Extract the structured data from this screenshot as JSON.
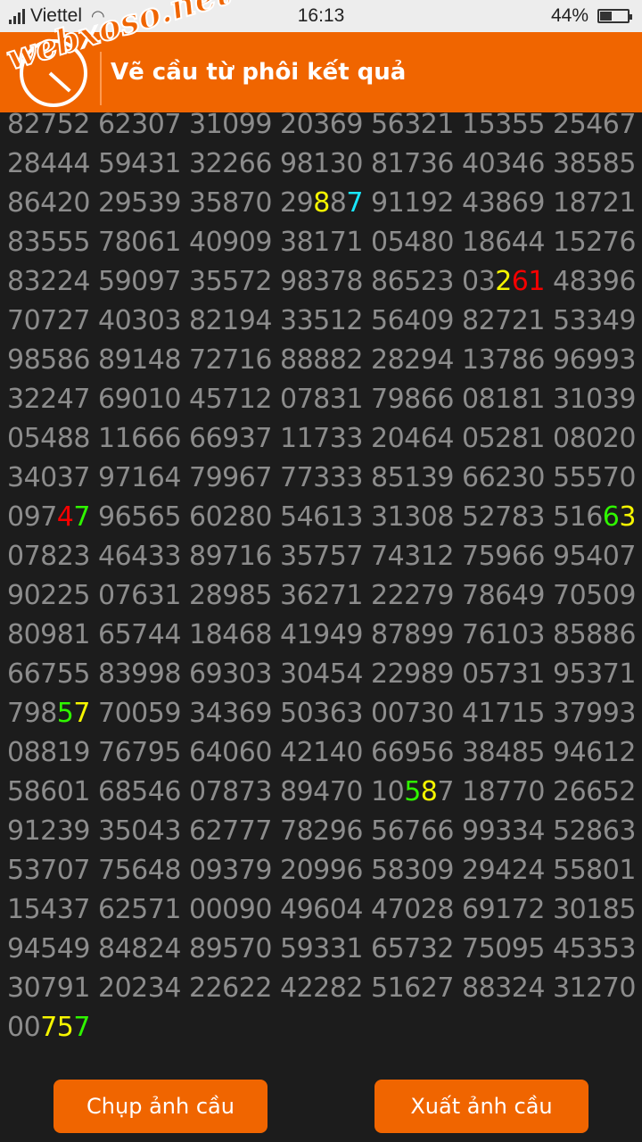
{
  "status_bar": {
    "carrier": "Viettel",
    "time": "16:13",
    "battery_percent": "44%",
    "battery_level": 0.44,
    "icons": [
      "signal-icon",
      "wifi-icon",
      "battery-icon"
    ]
  },
  "header": {
    "watermark": "webxoso.net",
    "title": "Vẽ cầu từ phôi kết quả",
    "background": "#f06500"
  },
  "grid": {
    "text_color": "#8c8c8c",
    "highlight_colors": {
      "yellow": "#f5f500",
      "cyan": "#19e7ff",
      "red": "#f50000",
      "green": "#2ff500"
    },
    "rows": [
      [
        "82752",
        "62307",
        "31099",
        "20369",
        "56321",
        "15355",
        "25467"
      ],
      [
        "28444",
        "59431",
        "32266",
        "98130",
        "81736",
        "40346",
        "38585"
      ],
      [
        "86420",
        "29539",
        "35870",
        "29887",
        "91192",
        "43869",
        "18721"
      ],
      [
        "83555",
        "78061",
        "40909",
        "38171",
        "05480",
        "18644",
        "15276"
      ],
      [
        "83224",
        "59097",
        "35572",
        "98378",
        "86523",
        "03261",
        "48396"
      ],
      [
        "70727",
        "40303",
        "82194",
        "33512",
        "56409",
        "82721",
        "53349"
      ],
      [
        "98586",
        "89148",
        "72716",
        "88882",
        "28294",
        "13786",
        "96993"
      ],
      [
        "32247",
        "69010",
        "45712",
        "07831",
        "79866",
        "08181",
        "31039"
      ],
      [
        "05488",
        "11666",
        "66937",
        "11733",
        "20464",
        "05281",
        "08020"
      ],
      [
        "34037",
        "97164",
        "79967",
        "77333",
        "85139",
        "66230",
        "55570"
      ],
      [
        "09747",
        "96565",
        "60280",
        "54613",
        "31308",
        "52783",
        "51663"
      ],
      [
        "07823",
        "46433",
        "89716",
        "35757",
        "74312",
        "75966",
        "95407"
      ],
      [
        "90225",
        "07631",
        "28985",
        "36271",
        "22279",
        "78649",
        "70509"
      ],
      [
        "80981",
        "65744",
        "18468",
        "41949",
        "87899",
        "76103",
        "85886"
      ],
      [
        "66755",
        "83998",
        "69303",
        "30454",
        "22989",
        "05731",
        "95371"
      ],
      [
        "79857",
        "70059",
        "34369",
        "50363",
        "00730",
        "41715",
        "37993"
      ],
      [
        "08819",
        "76795",
        "64060",
        "42140",
        "66956",
        "38485",
        "94612"
      ],
      [
        "58601",
        "68546",
        "07873",
        "89470",
        "10587",
        "18770",
        "26652"
      ],
      [
        "91239",
        "35043",
        "62777",
        "78296",
        "56766",
        "99334",
        "52863"
      ],
      [
        "53707",
        "75648",
        "09379",
        "20996",
        "58309",
        "29424",
        "55801"
      ],
      [
        "15437",
        "62571",
        "00090",
        "49604",
        "47028",
        "69172",
        "30185"
      ],
      [
        "94549",
        "84824",
        "89570",
        "59331",
        "65732",
        "75095",
        "45353"
      ],
      [
        "30791",
        "20234",
        "22622",
        "42282",
        "51627",
        "88324",
        "31270"
      ],
      [
        "00757"
      ]
    ],
    "highlights": [
      {
        "row": 2,
        "col": 3,
        "digits": [
          {
            "index": 2,
            "color": "y"
          },
          {
            "index": 4,
            "color": "c"
          }
        ]
      },
      {
        "row": 4,
        "col": 5,
        "digits": [
          {
            "index": 2,
            "color": "y"
          },
          {
            "index": 3,
            "color": "r"
          },
          {
            "index": 4,
            "color": "r"
          }
        ]
      },
      {
        "row": 10,
        "col": 0,
        "digits": [
          {
            "index": 3,
            "color": "r"
          },
          {
            "index": 4,
            "color": "g"
          }
        ]
      },
      {
        "row": 10,
        "col": 6,
        "digits": [
          {
            "index": 3,
            "color": "g"
          },
          {
            "index": 4,
            "color": "y"
          }
        ]
      },
      {
        "row": 15,
        "col": 0,
        "digits": [
          {
            "index": 3,
            "color": "g"
          },
          {
            "index": 4,
            "color": "y"
          }
        ]
      },
      {
        "row": 17,
        "col": 4,
        "digits": [
          {
            "index": 2,
            "color": "g"
          },
          {
            "index": 3,
            "color": "y"
          }
        ]
      },
      {
        "row": 23,
        "col": 0,
        "digits": [
          {
            "index": 2,
            "color": "y"
          },
          {
            "index": 3,
            "color": "y"
          },
          {
            "index": 4,
            "color": "g"
          }
        ]
      }
    ]
  },
  "buttons": {
    "capture_label": "Chụp ảnh cầu",
    "export_label": "Xuất ảnh cầu"
  }
}
